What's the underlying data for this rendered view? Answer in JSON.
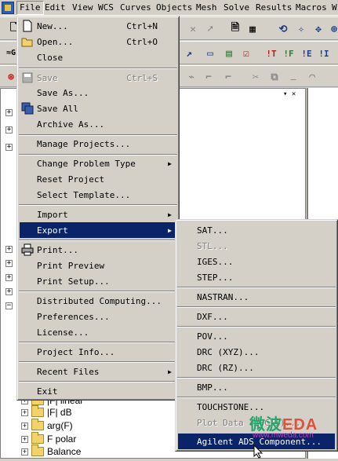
{
  "menubar": {
    "items": [
      "File",
      "Edit",
      "View",
      "WCS",
      "Curves",
      "Objects",
      "Mesh",
      "Solve",
      "Results",
      "Macros",
      "W"
    ]
  },
  "toolbar_right": {
    "labels": [
      "!T",
      "!F",
      "!E",
      "!I"
    ]
  },
  "file_menu": {
    "items": [
      {
        "label": "New...",
        "shortcut": "Ctrl+N",
        "icon": "new-file-icon"
      },
      {
        "label": "Open...",
        "shortcut": "Ctrl+O",
        "icon": "open-folder-icon"
      },
      {
        "label": "Close",
        "shortcut": ""
      },
      {
        "label": "Save",
        "shortcut": "Ctrl+S",
        "icon": "save-icon",
        "disabled": true
      },
      {
        "label": "Save As...",
        "shortcut": ""
      },
      {
        "label": "Save All",
        "shortcut": "",
        "icon": "save-all-icon"
      },
      {
        "label": "Archive As...",
        "shortcut": ""
      },
      {
        "label": "Manage Projects...",
        "shortcut": ""
      },
      {
        "label": "Change Problem Type",
        "shortcut": "",
        "submenu": true
      },
      {
        "label": "Reset Project",
        "shortcut": ""
      },
      {
        "label": "Select Template...",
        "shortcut": ""
      },
      {
        "label": "Import",
        "shortcut": "",
        "submenu": true
      },
      {
        "label": "Export",
        "shortcut": "",
        "submenu": true,
        "highlighted": true
      },
      {
        "label": "Print...",
        "shortcut": "",
        "icon": "printer-icon"
      },
      {
        "label": "Print Preview",
        "shortcut": ""
      },
      {
        "label": "Print Setup...",
        "shortcut": ""
      },
      {
        "label": "Distributed Computing...",
        "shortcut": ""
      },
      {
        "label": "Preferences...",
        "shortcut": ""
      },
      {
        "label": "License...",
        "shortcut": ""
      },
      {
        "label": "Project Info...",
        "shortcut": ""
      },
      {
        "label": "Recent Files",
        "shortcut": "",
        "submenu": true
      },
      {
        "label": "Exit",
        "shortcut": ""
      }
    ]
  },
  "export_menu": {
    "items": [
      {
        "label": "SAT..."
      },
      {
        "label": "STL...",
        "disabled": true
      },
      {
        "label": "IGES..."
      },
      {
        "label": "STEP..."
      },
      {
        "label": "NASTRAN..."
      },
      {
        "label": "DXF..."
      },
      {
        "label": "POV..."
      },
      {
        "label": "DRC (XYZ)..."
      },
      {
        "label": "DRC (RZ)..."
      },
      {
        "label": "BMP..."
      },
      {
        "label": "TOUCHSTONE..."
      },
      {
        "label": "Plot Data (ASCII)...",
        "disabled": true
      },
      {
        "label": "Agilent ADS Component...",
        "highlighted": true
      }
    ]
  },
  "tree": {
    "visible_items": [
      {
        "label": "|F| linear"
      },
      {
        "label": "|F| dB"
      },
      {
        "label": "arg(F)"
      },
      {
        "label": "F polar"
      },
      {
        "label": "Balance"
      }
    ]
  },
  "watermark": {
    "text_cn": "微波",
    "text_eda": "EDA",
    "url": "www.mweda.com"
  },
  "colors": {
    "menu_bg": "#d4d0c8",
    "highlight": "#0a246a",
    "highlight_text": "#ffffff",
    "disabled_text": "#808080"
  }
}
